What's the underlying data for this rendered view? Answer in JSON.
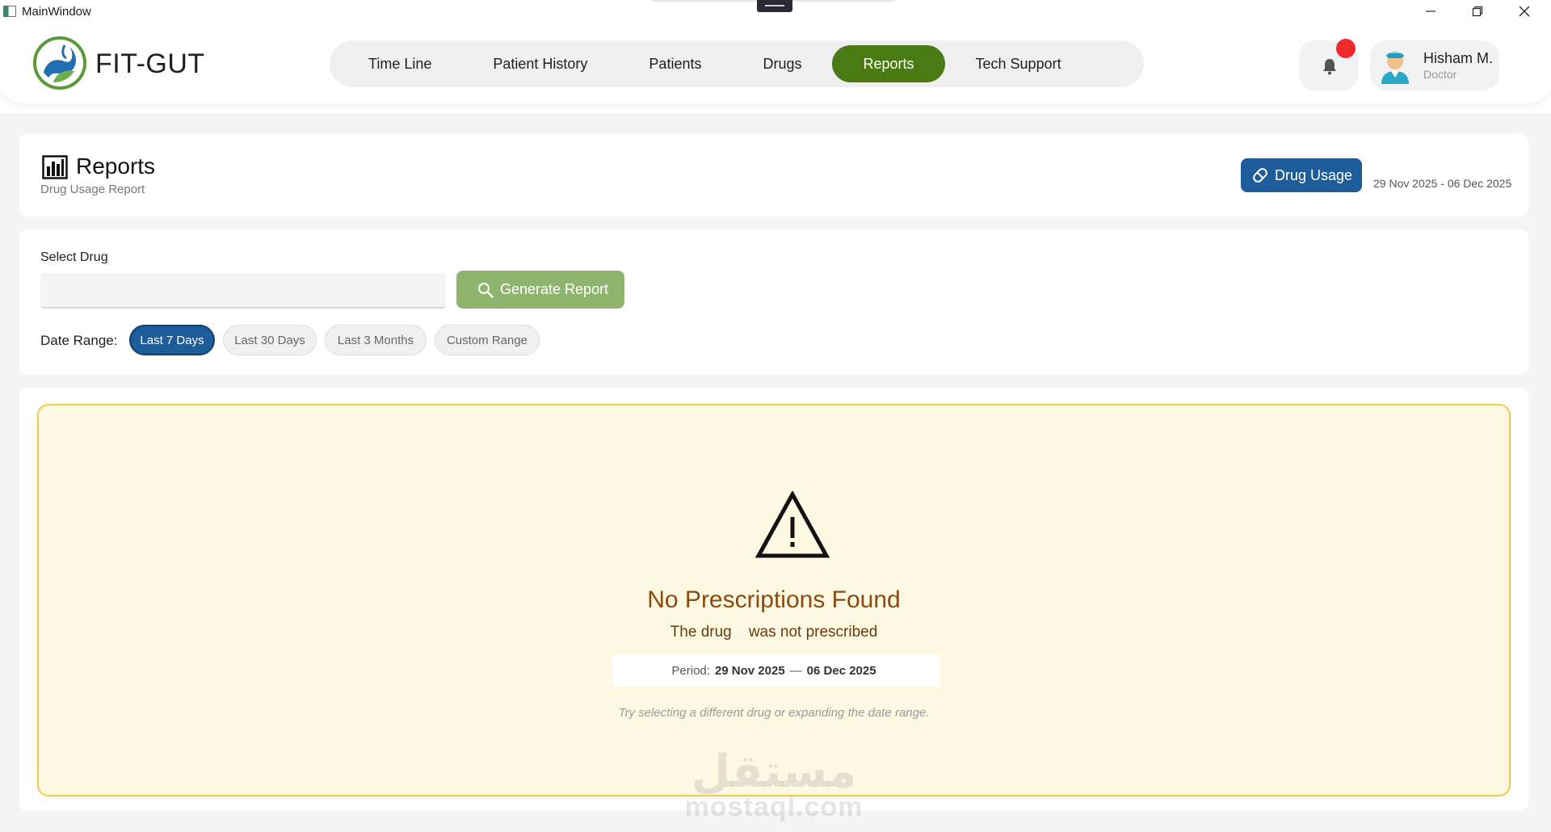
{
  "window": {
    "title": "MainWindow"
  },
  "brand": {
    "name": "FIT-GUT"
  },
  "nav": {
    "tabs": [
      {
        "label": "Time Line",
        "active": false
      },
      {
        "label": "Patient History",
        "active": false
      },
      {
        "label": "Patients",
        "active": false
      },
      {
        "label": "Drugs",
        "active": false
      },
      {
        "label": "Reports",
        "active": true
      },
      {
        "label": "Tech Support",
        "active": false
      }
    ]
  },
  "user": {
    "name": "Hisham M.",
    "role": "Doctor"
  },
  "page": {
    "title": "Reports",
    "subtitle": "Drug Usage Report",
    "report_type_button": "Drug Usage",
    "date_range": "29 Nov 2025 - 06 Dec 2025"
  },
  "filters": {
    "select_drug_label": "Select Drug",
    "select_drug_value": "",
    "generate_button": "Generate Report",
    "date_range_label": "Date Range:",
    "ranges": [
      {
        "label": "Last 7 Days",
        "active": true
      },
      {
        "label": "Last 30 Days",
        "active": false
      },
      {
        "label": "Last 3 Months",
        "active": false
      },
      {
        "label": "Custom Range",
        "active": false
      }
    ]
  },
  "empty_state": {
    "title": "No Prescriptions Found",
    "message": "The drug    was not prescribed",
    "period_label": "Period:",
    "period_start": "29 Nov 2025",
    "period_sep": "—",
    "period_end": "06 Dec 2025",
    "hint": "Try selecting a different drug or expanding the date range."
  },
  "watermark": {
    "line1": "مستقل",
    "line2": "mostaql.com"
  },
  "colors": {
    "accent_green": "#4a7a14",
    "accent_blue": "#1f5c9a",
    "generate_green": "#8fb46e",
    "notification_red": "#f02a2a",
    "empty_bg": "#fdf8e1",
    "empty_border": "#f2c94c",
    "empty_title": "#8a4a10"
  }
}
